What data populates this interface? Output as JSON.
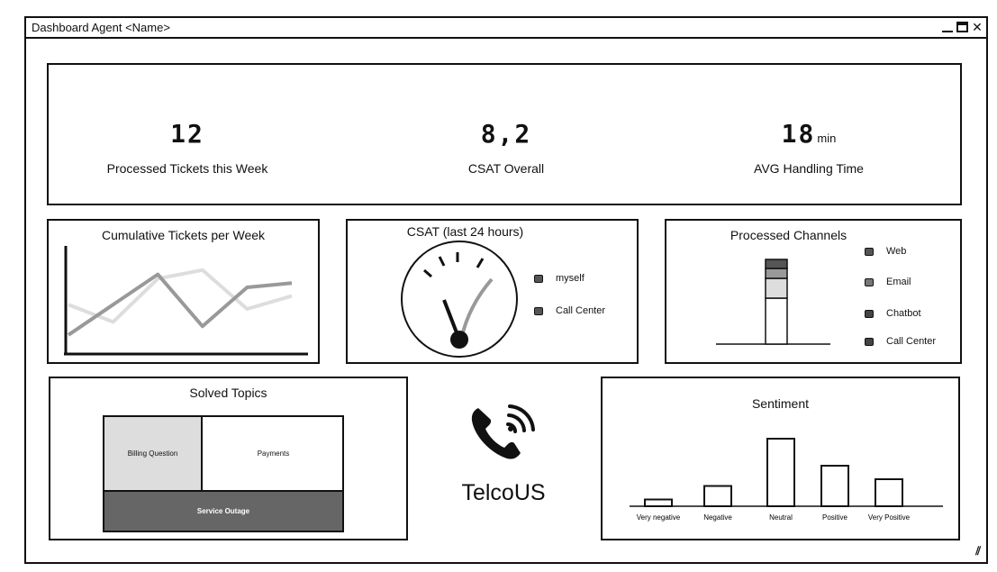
{
  "window": {
    "title": "Dashboard Agent <Name>"
  },
  "kpis": [
    {
      "value": "12",
      "unit": "",
      "label": "Processed Tickets this Week"
    },
    {
      "value": "8,2",
      "unit": "",
      "label": "CSAT Overall"
    },
    {
      "value": "18",
      "unit": "min",
      "label": "AVG Handling Time"
    }
  ],
  "cumulative": {
    "title": "Cumulative Tickets per Week",
    "chart_data": {
      "type": "line",
      "series": [
        {
          "values": [
            0.55,
            0.35,
            0.85,
            0.95,
            0.5,
            0.65
          ]
        },
        {
          "values": [
            0.2,
            0.55,
            0.9,
            0.3,
            0.75,
            0.8
          ]
        }
      ]
    }
  },
  "csat24": {
    "title": "CSAT (last 24 hours)",
    "legend": [
      {
        "label": "myself",
        "color": "#555555"
      },
      {
        "label": "Call Center",
        "color": "#555555"
      }
    ]
  },
  "channels": {
    "title": "Processed Channels",
    "legend": [
      {
        "label": "Web",
        "color": "#555555"
      },
      {
        "label": "Email",
        "color": "#777777"
      },
      {
        "label": "Chatbot",
        "color": "#444444"
      },
      {
        "label": "Call Center",
        "color": "#444444"
      }
    ],
    "colors": [
      "#555555",
      "#999999",
      "#dddddd",
      "#ffffff"
    ]
  },
  "topics": {
    "title": "Solved Topics",
    "cells": [
      {
        "label": "Billing Question",
        "color": "#dddddd"
      },
      {
        "label": "Payments",
        "color": "#ffffff"
      },
      {
        "label": "Service Outage",
        "color": "#666666"
      }
    ]
  },
  "brand": {
    "name": "TelcoUS",
    "icon": "phone-ringing-icon"
  },
  "sentiment": {
    "title": "Sentiment",
    "chart_data": {
      "type": "bar",
      "categories": [
        "Very negative",
        "Negative",
        "Neutral",
        "Positive",
        "Very Positive"
      ],
      "values": [
        1,
        3,
        10,
        6,
        4
      ]
    }
  }
}
